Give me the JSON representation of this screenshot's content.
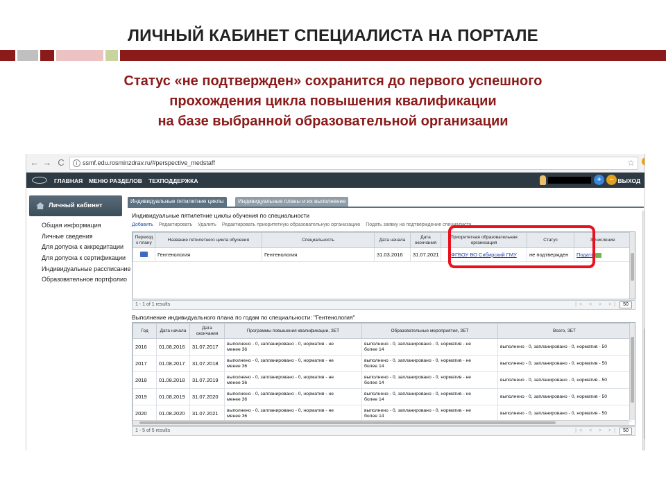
{
  "slide": {
    "title": "ЛИЧНЫЙ КАБИНЕТ СПЕЦИАЛИСТА НА ПОРТАЛЕ",
    "subtitle_lines": [
      "Статус «не подтвержден» сохранится до первого успешного",
      "прохождения цикла повышения квалификации",
      "на базе выбранной образовательной организации"
    ],
    "deco_colors": [
      "#8b1a1a",
      "#c0c0c0",
      "#d9b0b0",
      "#e7c0c0",
      "#c8d4a0",
      "#8b1a1a"
    ]
  },
  "browser": {
    "back_icon": "←",
    "forward_icon": "→",
    "reload_icon": "C",
    "info_icon": "i",
    "url": "ssmf.edu.rosminzdrav.ru/#perspective_medstaff",
    "star_icon": "☆"
  },
  "app": {
    "menu": [
      "ГЛАВНАЯ",
      "МЕНЮ РАЗДЕЛОВ",
      "ТЕХПОДДЕРЖКА"
    ],
    "zoom_in": "+",
    "zoom_out": "−",
    "exit_label": "ВЫХОД"
  },
  "sidebar": {
    "header": "Личный кабинет",
    "items": [
      "Общая информация",
      "Личные сведения",
      "Для допуска к аккредитации",
      "Для допуска к сертификации",
      "Индивидуальные рассписание",
      "Образовательное портфолио"
    ]
  },
  "tabs": [
    {
      "label": "Индивидуальные пятилетние циклы",
      "active": true
    },
    {
      "label": "Индивидуальные планы и их выполнение",
      "active": false
    }
  ],
  "cycles_panel": {
    "title": "Индивидуальные пятилетние циклы обучения по специальности",
    "toolbar": [
      "Добавить",
      "Редактировать",
      "Удалить",
      "Редактировать приоритетную образовательную организацию",
      "Подать заявку на подтверждение специалиста"
    ],
    "columns": [
      "Переход к плану",
      "Название пятилетнего цикла обучения",
      "Специальность",
      "Дата начала",
      "Дата окончания",
      "Приоритетная образовательная организация",
      "Статус",
      "Зачисление"
    ],
    "rows": [
      {
        "name": "Гентенология",
        "specialty": "Гентенология",
        "start": "31.03.2016",
        "end": "31.07.2021",
        "org": "ФГБОУ ВО Сибирский ГМУ",
        "status": "не подтвержден",
        "enroll": "Подать"
      }
    ],
    "pager_text": "1 - 1 of 1 results",
    "pager_controls": "|< < > >|",
    "page_size": "50"
  },
  "plan_panel": {
    "title": "Выполнение индивидуального плана по годам по специальности: \"Гентенология\"",
    "columns": [
      "Год",
      "Дата начала",
      "Дата окончания",
      "Программы повышения квалификации, ЗЕТ",
      "Образовательные мероприятия, ЗЕТ",
      "Всего, ЗЕТ"
    ],
    "rows": [
      {
        "year": "2016",
        "start": "01.08.2016",
        "end": "31.07.2017",
        "programs": [
          "выполнено - 0, запланировано - 0, норматив - не",
          "менее 36"
        ],
        "events": [
          "выполнено - 0, запланировано - 0, норматив - не",
          "более 14"
        ],
        "total": "выполнено - 0, запланировано - 0, норматив - 50"
      },
      {
        "year": "2017",
        "start": "01.08.2017",
        "end": "31.07.2018",
        "programs": [
          "выполнено - 0, запланировано - 0, норматив - не",
          "менее 36"
        ],
        "events": [
          "выполнено - 0, запланировано - 0, норматив - не",
          "более 14"
        ],
        "total": "выполнено - 0, запланировано - 0, норматив - 50"
      },
      {
        "year": "2018",
        "start": "01.08.2018",
        "end": "31.07.2019",
        "programs": [
          "выполнено - 0, запланировано - 0, норматив - не",
          "менее 36"
        ],
        "events": [
          "выполнено - 0, запланировано - 0, норматив - не",
          "более 14"
        ],
        "total": "выполнено - 0, запланировано - 0, норматив - 50"
      },
      {
        "year": "2019",
        "start": "01.08.2019",
        "end": "31.07.2020",
        "programs": [
          "выполнено - 0, запланировано - 0, норматив - не",
          "менее 36"
        ],
        "events": [
          "выполнено - 0, запланировано - 0, норматив - не",
          "более 14"
        ],
        "total": "выполнено - 0, запланировано - 0, норматив - 50"
      },
      {
        "year": "2020",
        "start": "01.08.2020",
        "end": "31.07.2021",
        "programs": [
          "выполнено - 0, запланировано - 0, норматив - не",
          "менее 36"
        ],
        "events": [
          "выполнено - 0, запланировано - 0, норматив - не",
          "более 14"
        ],
        "total": "выполнено - 0, запланировано - 0, норматив - 50"
      }
    ],
    "pager_text": "1 - 5 of 5 results",
    "pager_controls": "|< < > >|",
    "page_size": "50"
  }
}
